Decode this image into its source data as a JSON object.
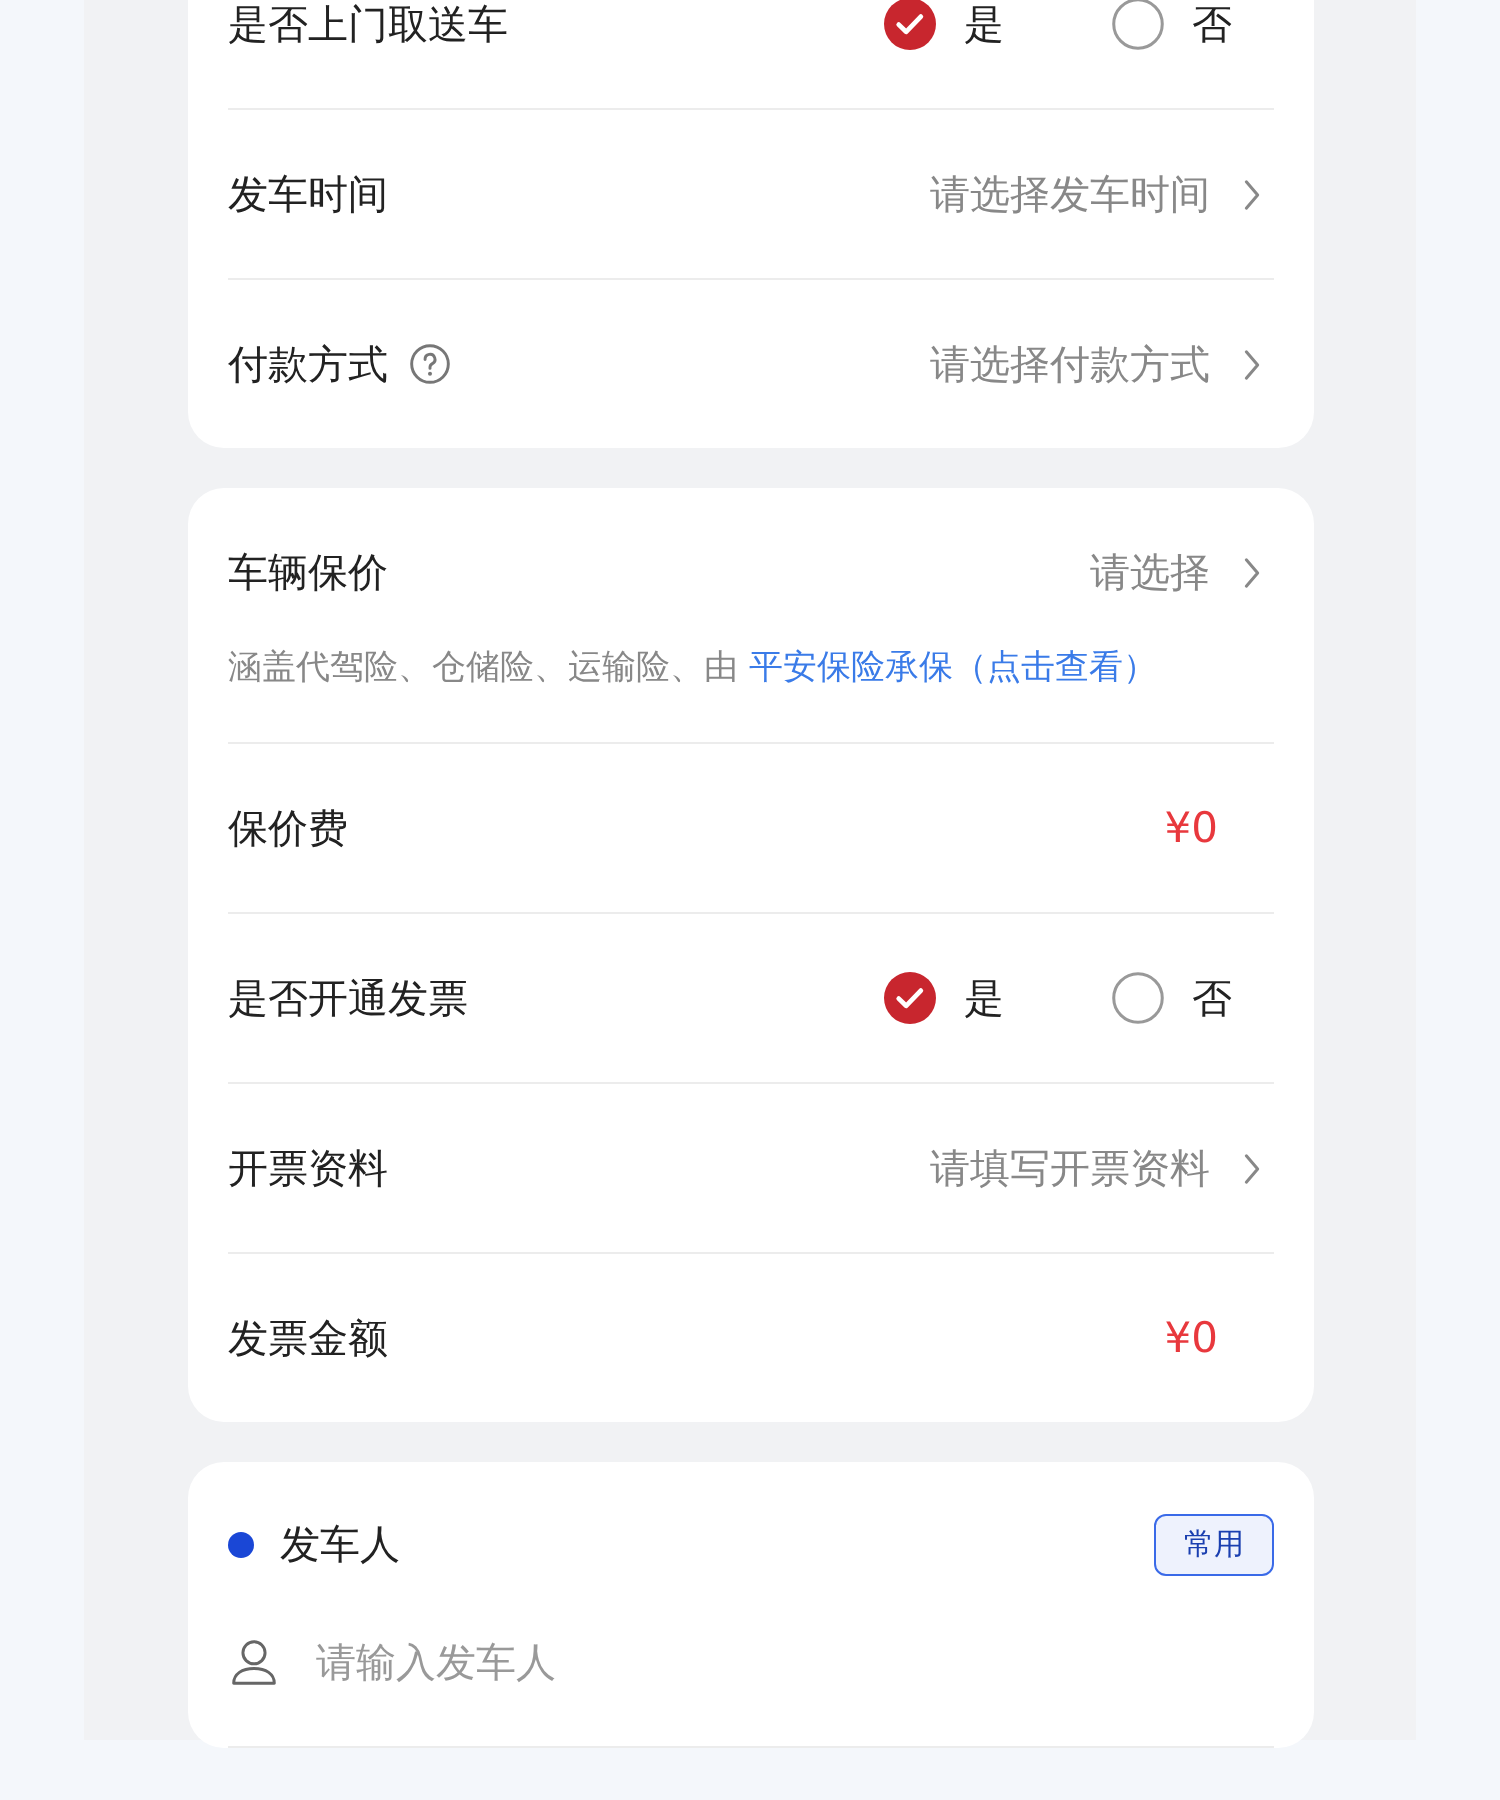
{
  "cards": [
    {
      "rows": [
        {
          "kind": "radio",
          "label": "是否上门取送车",
          "options": [
            {
              "label": "是",
              "selected": true
            },
            {
              "label": "否",
              "selected": false
            }
          ]
        },
        {
          "kind": "select",
          "label": "发车时间",
          "placeholder": "请选择发车时间"
        },
        {
          "kind": "select",
          "label": "付款方式",
          "placeholder": "请选择付款方式",
          "help": true
        }
      ]
    },
    {
      "rows": [
        {
          "kind": "select",
          "label": "车辆保价",
          "placeholder": "请选择",
          "note": "涵盖代驾险、仓储险、运输险、由",
          "note_link": "平安保险承保（点击查看）"
        },
        {
          "kind": "amount",
          "label": "保价费",
          "value": "¥0"
        },
        {
          "kind": "radio",
          "label": "是否开通发票",
          "options": [
            {
              "label": "是",
              "selected": true
            },
            {
              "label": "否",
              "selected": false
            }
          ]
        },
        {
          "kind": "select",
          "label": "开票资料",
          "placeholder": "请填写开票资料"
        },
        {
          "kind": "amount",
          "label": "发票金额",
          "value": "¥0"
        }
      ]
    }
  ],
  "sender": {
    "title": "发车人",
    "color": "#1a47d6",
    "badge": "常用",
    "placeholder": "请输入发车人"
  }
}
